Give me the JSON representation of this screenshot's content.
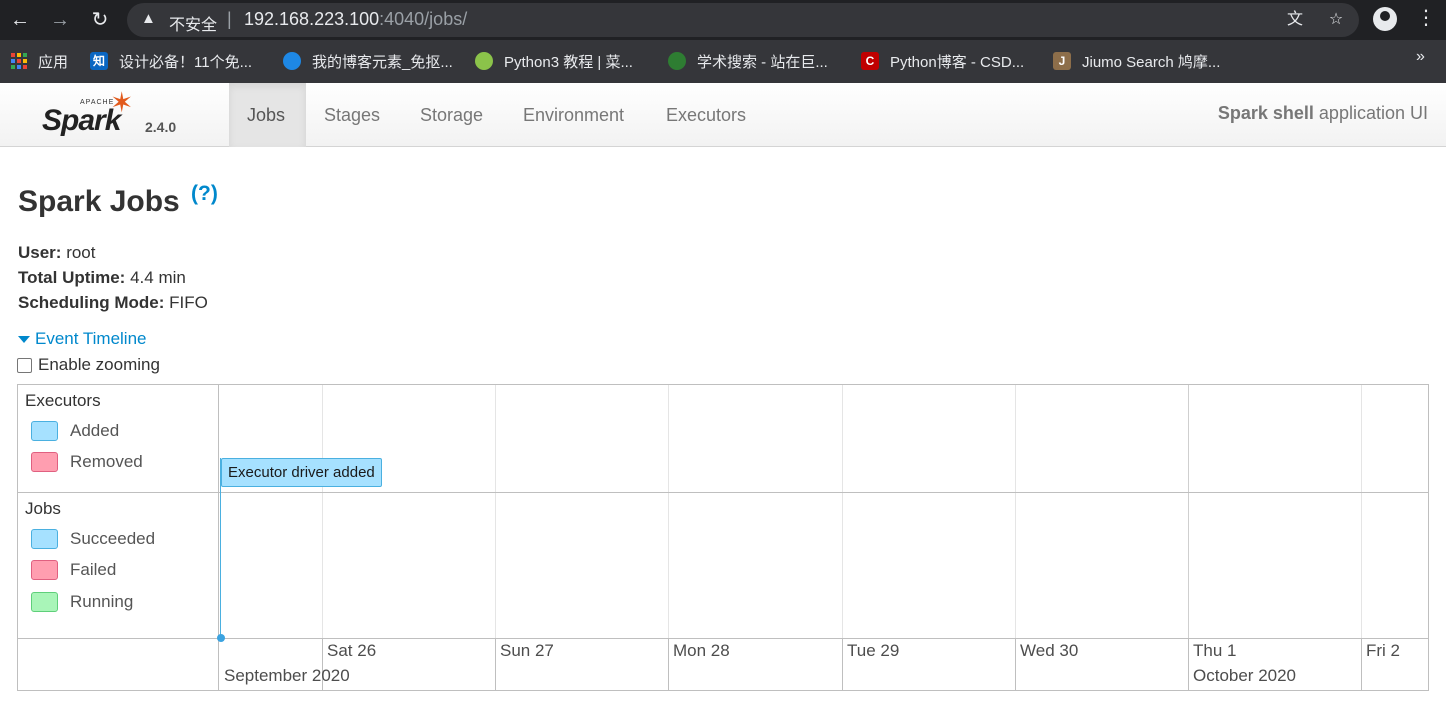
{
  "browser": {
    "insecure_label": "不安全",
    "url_host": "192.168.223.100",
    "url_rest": ":4040/jobs/",
    "bookmarks": [
      {
        "label": "应用",
        "icon": "apps-grid-icon"
      },
      {
        "label": "设计必备！11个免...",
        "icon": "zhihu-icon",
        "icon_text": "知",
        "color": "#0a66c2"
      },
      {
        "label": "我的博客元素_免抠...",
        "icon": "blog-icon",
        "color": "#1e88e5"
      },
      {
        "label": "Python3 教程 | 菜...",
        "icon": "runoob-icon",
        "color": "#8bc34a"
      },
      {
        "label": "学术搜索 - 站在巨...",
        "icon": "scholar-icon",
        "color": "#2e7d32"
      },
      {
        "label": "Python博客 - CSD...",
        "icon": "csdn-icon",
        "icon_text": "C",
        "color": "#c00000"
      },
      {
        "label": "Jiumo Search 鸠摩...",
        "icon": "jiumo-icon",
        "icon_text": "J",
        "color": "#8d6e4a"
      }
    ],
    "more_label": "»"
  },
  "spark": {
    "logo_text": "Spark",
    "logo_apache": "APACHE",
    "version": "2.4.0",
    "tabs": [
      "Jobs",
      "Stages",
      "Storage",
      "Environment",
      "Executors"
    ],
    "active_tab": "Jobs",
    "app_title_bold": "Spark shell",
    "app_title_rest": " application UI"
  },
  "page": {
    "title": "Spark Jobs",
    "help": "(?)",
    "user_label": "User:",
    "user_value": " root",
    "uptime_label": "Total Uptime:",
    "uptime_value": " 4.4 min",
    "mode_label": "Scheduling Mode:",
    "mode_value": " FIFO",
    "timeline_label": "Event Timeline",
    "zoom_label": "Enable zooming"
  },
  "timeline": {
    "executors_title": "Executors",
    "executors_legend": [
      {
        "label": "Added",
        "fill": "#a6e1ff",
        "border": "#4ab0e0"
      },
      {
        "label": "Removed",
        "fill": "#ff9eb0",
        "border": "#e06080"
      }
    ],
    "jobs_title": "Jobs",
    "jobs_legend": [
      {
        "label": "Succeeded",
        "fill": "#a6e1ff",
        "border": "#4ab0e0"
      },
      {
        "label": "Failed",
        "fill": "#ff9eb0",
        "border": "#e06080"
      },
      {
        "label": "Running",
        "fill": "#a9f5b8",
        "border": "#5fcf7a"
      }
    ],
    "event_label": "Executor driver added",
    "days": [
      "Sat 26",
      "Sun 27",
      "Mon 28",
      "Tue 29",
      "Wed 30",
      "Thu 1",
      "Fri 2"
    ],
    "months": [
      "September 2020",
      "October 2020"
    ]
  }
}
